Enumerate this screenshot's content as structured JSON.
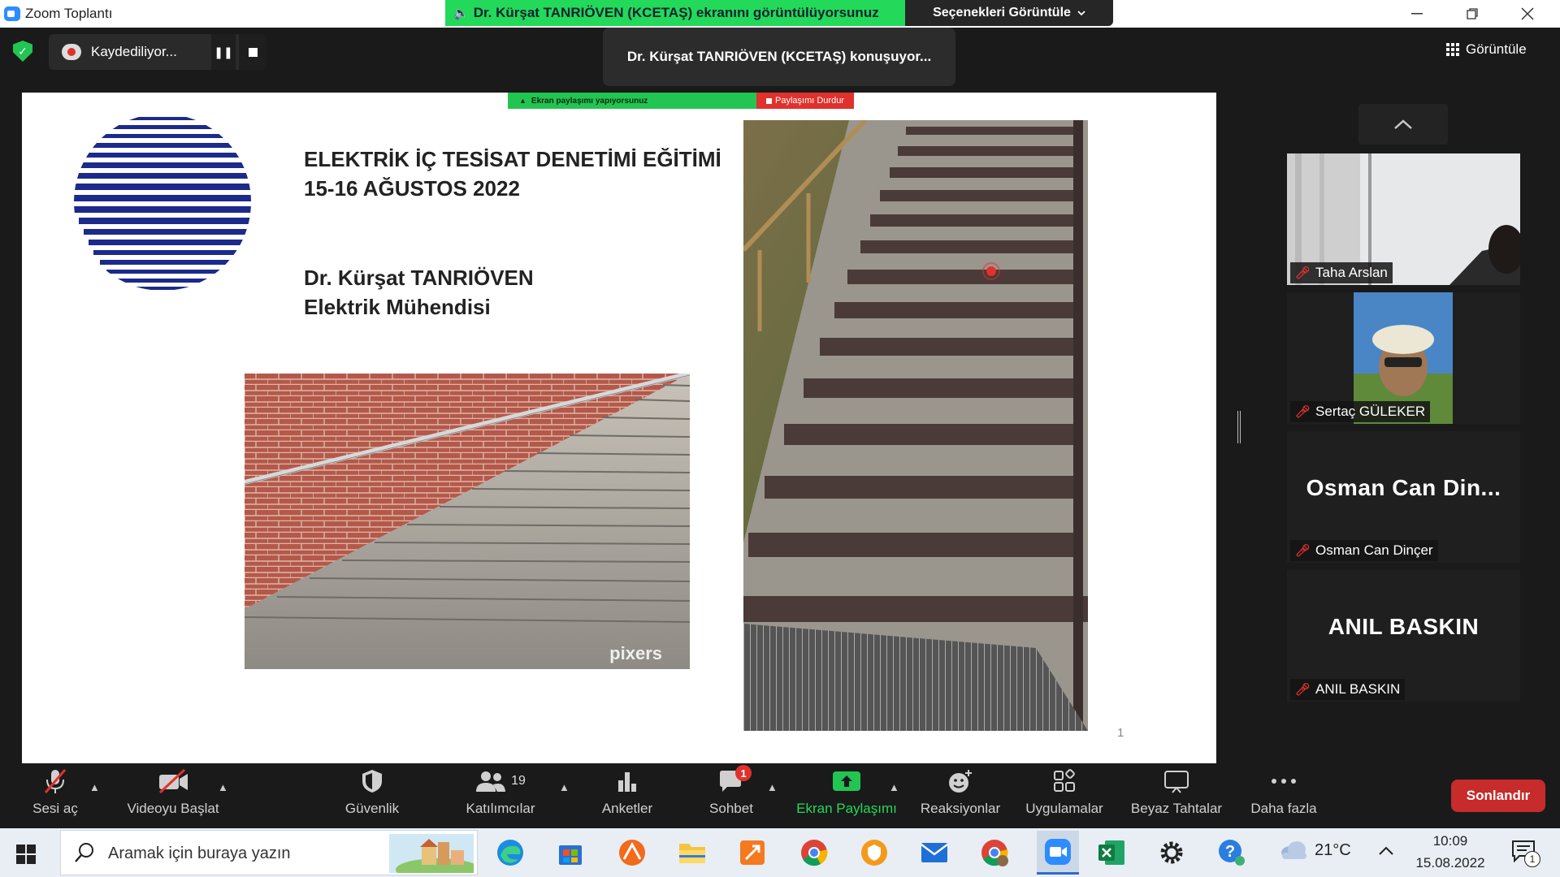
{
  "window": {
    "title": "Zoom Toplantı",
    "share_banner": "Dr. Kürşat TANRIÖVEN (KCETAŞ) ekranını görüntülüyorsunuz",
    "view_options": "Seçenekleri Görüntüle"
  },
  "top": {
    "recording_label": "Kaydediliyor...",
    "speaking_label": "Dr. Kürşat TANRIÖVEN (KCETAŞ) konuşuyor...",
    "view_label": "Görüntüle"
  },
  "slide": {
    "share_bar_label": "Ekran paylaşımı yapıyorsunuz",
    "stop_share_label": "Paylaşımı Durdur",
    "title_line1": "ELEKTRİK İÇ TESİSAT DENETİMİ EĞİTİMİ",
    "title_line2": "15-16 AĞUSTOS 2022",
    "author_line1": "Dr. Kürşat TANRIÖVEN",
    "author_line2": "Elektrik Mühendisi",
    "watermark": "pixers",
    "page_number": "1"
  },
  "participants": [
    {
      "name": "Taha Arslan",
      "muted": true,
      "video": true
    },
    {
      "name": "Sertaç GÜLEKER",
      "muted": true,
      "video": true
    },
    {
      "name": "Osman Can Dinçer",
      "display_name": "Osman Can Din...",
      "muted": true,
      "video": false
    },
    {
      "name": "ANIL BASKIN",
      "display_name": "ANIL BASKIN",
      "muted": true,
      "video": false
    }
  ],
  "toolbar": {
    "unmute": "Sesi aç",
    "start_video": "Videoyu Başlat",
    "security": "Güvenlik",
    "participants": "Katılımcılar",
    "participant_count": "19",
    "polls": "Anketler",
    "chat": "Sohbet",
    "chat_badge": "1",
    "share_screen": "Ekran Paylaşımı",
    "reactions": "Reaksiyonlar",
    "apps": "Uygulamalar",
    "whiteboards": "Beyaz Tahtalar",
    "more": "Daha fazla",
    "end": "Sonlandır"
  },
  "taskbar": {
    "search_placeholder": "Aramak için buraya yazın",
    "weather": "21°C",
    "time": "10:09",
    "date": "15.08.2022",
    "notification_count": "1"
  },
  "colors": {
    "zoom_green": "#23d959",
    "zoom_red": "#e0312d",
    "end_red": "#c72b2b",
    "logo_blue": "#1c2a8c",
    "toolbar_bg": "#1a1a1a"
  }
}
